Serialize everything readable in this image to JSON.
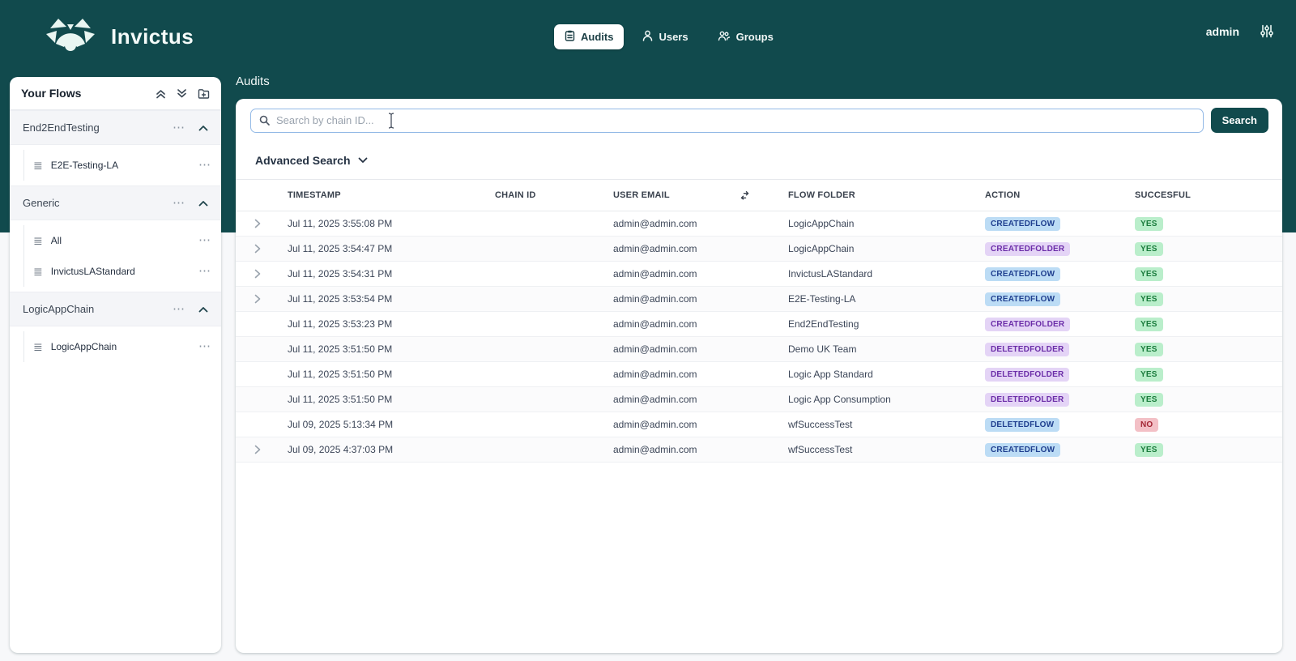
{
  "colors": {
    "header_teal": "#114a4d",
    "badge_blue_bg": "#bcdcf5",
    "badge_blue_text": "#1f3f8f",
    "badge_purple_bg": "#e4d4f6",
    "badge_purple_text": "#6b2da8",
    "badge_green_bg": "#baeecb",
    "badge_green_text": "#1b7c3d",
    "badge_red_bg": "#f3c0c6",
    "badge_red_text": "#a32735"
  },
  "header": {
    "brand": "Invictus",
    "nav": [
      {
        "label": "Audits",
        "icon": "audits-icon",
        "active": true
      },
      {
        "label": "Users",
        "icon": "users-icon",
        "active": false
      },
      {
        "label": "Groups",
        "icon": "groups-icon",
        "active": false
      }
    ],
    "user": "admin",
    "settings_icon": "sliders-icon"
  },
  "sidebar": {
    "title": "Your Flows",
    "toolbar_icons": [
      "collapse-all-icon",
      "expand-all-icon",
      "add-folder-icon"
    ],
    "folders": [
      {
        "name": "End2EndTesting",
        "expanded": true,
        "items": [
          "E2E-Testing-LA"
        ]
      },
      {
        "name": "Generic",
        "expanded": true,
        "items": [
          "All",
          "InvictusLAStandard"
        ]
      },
      {
        "name": "LogicAppChain",
        "expanded": true,
        "items": [
          "LogicAppChain"
        ]
      }
    ]
  },
  "main": {
    "title": "Audits",
    "search": {
      "placeholder": "Search by chain ID...",
      "value": "",
      "button": "Search"
    },
    "advanced_search_label": "Advanced Search",
    "table": {
      "columns": [
        "TIMESTAMP",
        "CHAIN ID",
        "USER EMAIL",
        "FLOW FOLDER",
        "ACTION",
        "SUCCESFUL"
      ],
      "rows": [
        {
          "expandable": true,
          "timestamp": "Jul 11, 2025 3:55:08 PM",
          "chain_id": "",
          "user_email": "admin@admin.com",
          "flow_folder": "LogicAppChain",
          "action": "CREATEDFLOW",
          "action_variant": "blue",
          "successful": "YES"
        },
        {
          "expandable": true,
          "timestamp": "Jul 11, 2025 3:54:47 PM",
          "chain_id": "",
          "user_email": "admin@admin.com",
          "flow_folder": "LogicAppChain",
          "action": "CREATEDFOLDER",
          "action_variant": "purple",
          "successful": "YES"
        },
        {
          "expandable": true,
          "timestamp": "Jul 11, 2025 3:54:31 PM",
          "chain_id": "",
          "user_email": "admin@admin.com",
          "flow_folder": "InvictusLAStandard",
          "action": "CREATEDFLOW",
          "action_variant": "blue",
          "successful": "YES"
        },
        {
          "expandable": true,
          "timestamp": "Jul 11, 2025 3:53:54 PM",
          "chain_id": "",
          "user_email": "admin@admin.com",
          "flow_folder": "E2E-Testing-LA",
          "action": "CREATEDFLOW",
          "action_variant": "blue",
          "successful": "YES"
        },
        {
          "expandable": false,
          "timestamp": "Jul 11, 2025 3:53:23 PM",
          "chain_id": "",
          "user_email": "admin@admin.com",
          "flow_folder": "End2EndTesting",
          "action": "CREATEDFOLDER",
          "action_variant": "purple",
          "successful": "YES"
        },
        {
          "expandable": false,
          "timestamp": "Jul 11, 2025 3:51:50 PM",
          "chain_id": "",
          "user_email": "admin@admin.com",
          "flow_folder": "Demo UK Team",
          "action": "DELETEDFOLDER",
          "action_variant": "purple",
          "successful": "YES"
        },
        {
          "expandable": false,
          "timestamp": "Jul 11, 2025 3:51:50 PM",
          "chain_id": "",
          "user_email": "admin@admin.com",
          "flow_folder": "Logic App Standard",
          "action": "DELETEDFOLDER",
          "action_variant": "purple",
          "successful": "YES"
        },
        {
          "expandable": false,
          "timestamp": "Jul 11, 2025 3:51:50 PM",
          "chain_id": "",
          "user_email": "admin@admin.com",
          "flow_folder": "Logic App Consumption",
          "action": "DELETEDFOLDER",
          "action_variant": "purple",
          "successful": "YES"
        },
        {
          "expandable": false,
          "timestamp": "Jul 09, 2025 5:13:34 PM",
          "chain_id": "",
          "user_email": "admin@admin.com",
          "flow_folder": "wfSuccessTest",
          "action": "DELETEDFLOW",
          "action_variant": "blue",
          "successful": "NO"
        },
        {
          "expandable": true,
          "timestamp": "Jul 09, 2025 4:37:03 PM",
          "chain_id": "",
          "user_email": "admin@admin.com",
          "flow_folder": "wfSuccessTest",
          "action": "CREATEDFLOW",
          "action_variant": "blue",
          "successful": "YES"
        }
      ]
    }
  }
}
